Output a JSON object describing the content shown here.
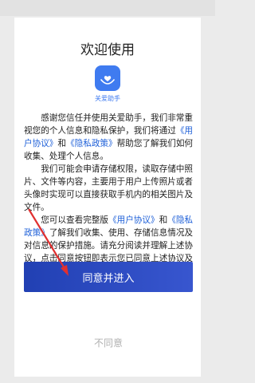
{
  "status_bar": {
    "left": "",
    "right": ""
  },
  "dialog": {
    "title": "欢迎使用",
    "app_name": "关爱助手",
    "paragraph1": {
      "before": "感谢您信任并使用关爱助手，我们非常重视您的个人信息和隐私保护，我们将通过",
      "link1": "《用户协议》",
      "mid": "和",
      "link2": "《隐私政策》",
      "after": "帮助您了解我们如何收集、处理个人信息。"
    },
    "paragraph2": "我们可能会申请存储权限，读取存储中照片、文件等内容，主要用于用户上传照片或者头像时实现可以直接获取手机内的相关图片及文件。",
    "paragraph3": {
      "before": "您可以查看完整版",
      "link1": "《用户协议》",
      "mid": "和",
      "link2": "《隐私政策》",
      "after": "了解我们收集、使用、存储信息情况及对信息的保护措施。请充分阅读并理解上述协议，点击同意按钮即表示您已同意上述协议及约定。"
    },
    "agree_label": "同意并进入",
    "decline_label": "不同意"
  },
  "colors": {
    "accent": "#3f7bf0",
    "button": "#2a47c0",
    "link": "#1d5fd8",
    "annotation_arrow": "#e03030"
  },
  "icons": {
    "logo": "heart-hand-icon"
  }
}
